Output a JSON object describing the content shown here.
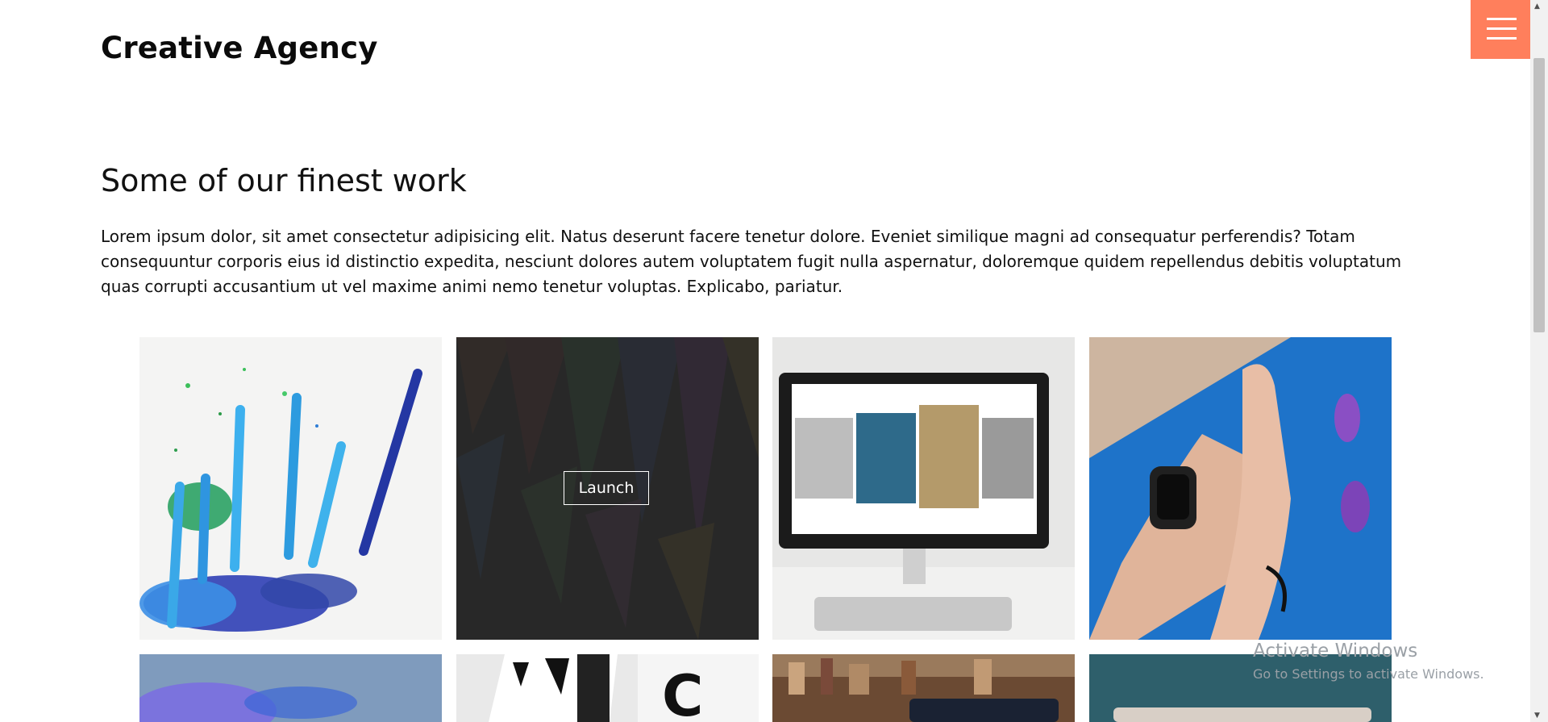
{
  "header": {
    "logo": "Creative Agency",
    "menu_icon": "hamburger-menu-icon",
    "accent_color": "#ff7f5c"
  },
  "work": {
    "title": "Some of our finest work",
    "intro": "Lorem ipsum dolor, sit amet consectetur adipisicing elit. Natus deserunt facere tenetur dolore. Eveniet similique magni ad consequatur perferendis? Totam consequuntur corporis eius id distinctio expedita, nesciunt dolores autem voluptatem fugit nulla aspernatur, doloremque quidem repellendus debitis voluptatum quas corrupti accusantium ut vel maxime animi nemo tenetur voluptas. Explicabo, pariatur.",
    "launch_label": "Launch",
    "gallery": [
      {
        "name": "colored-pencil-shavings"
      },
      {
        "name": "colored-pencil-tips"
      },
      {
        "name": "desktop-monitor-mockup"
      },
      {
        "name": "smartwatch-wrist"
      },
      {
        "name": "blue-blur"
      },
      {
        "name": "typography-posters"
      },
      {
        "name": "laptop-bookshelf"
      },
      {
        "name": "laptop-teal-background"
      }
    ]
  },
  "system_watermark": {
    "title": "Activate Windows",
    "subtitle": "Go to Settings to activate Windows."
  }
}
